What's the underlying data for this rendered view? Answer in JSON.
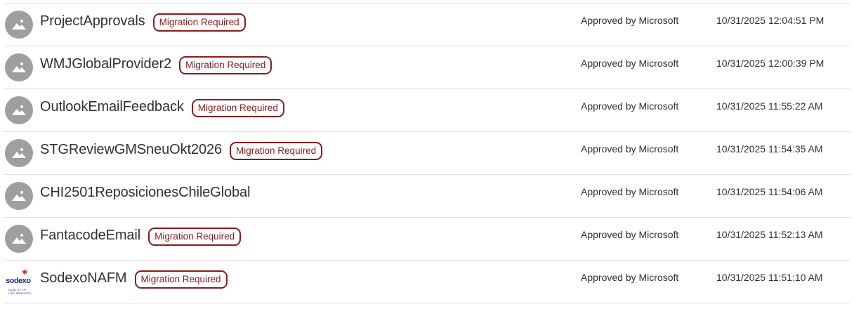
{
  "rows": [
    {
      "name": "ProjectApprovals",
      "badge": "Migration Required",
      "status": "Approved by Microsoft",
      "modified": "10/31/2025 12:04:51 PM",
      "icon": "placeholder-image-icon"
    },
    {
      "name": "WMJGlobalProvider2",
      "badge": "Migration Required",
      "status": "Approved by Microsoft",
      "modified": "10/31/2025 12:00:39 PM",
      "icon": "placeholder-image-icon"
    },
    {
      "name": "OutlookEmailFeedback",
      "badge": "Migration Required",
      "status": "Approved by Microsoft",
      "modified": "10/31/2025 11:55:22 AM",
      "icon": "placeholder-image-icon"
    },
    {
      "name": "STGReviewGMSneuOkt2026",
      "badge": "Migration Required",
      "status": "Approved by Microsoft",
      "modified": "10/31/2025 11:54:35 AM",
      "icon": "placeholder-image-icon"
    },
    {
      "name": "CHI2501ReposicionesChileGlobal",
      "badge": "",
      "status": "Approved by Microsoft",
      "modified": "10/31/2025 11:54:06 AM",
      "icon": "placeholder-image-icon"
    },
    {
      "name": "FantacodeEmail",
      "badge": "Migration Required",
      "status": "Approved by Microsoft",
      "modified": "10/31/2025 11:52:13 AM",
      "icon": "placeholder-image-icon"
    },
    {
      "name": "SodexoNAFM",
      "badge": "Migration Required",
      "status": "Approved by Microsoft",
      "modified": "10/31/2025 11:51:10 AM",
      "icon": "sodexo-logo-icon",
      "logo_text": "sodexo",
      "logo_tagline": "QUALITY OF LIFE SERVICES"
    }
  ],
  "colors": {
    "badge": "#8b1a1a",
    "icon_bg": "#a19f9d",
    "divider": "#e1dfdd"
  }
}
